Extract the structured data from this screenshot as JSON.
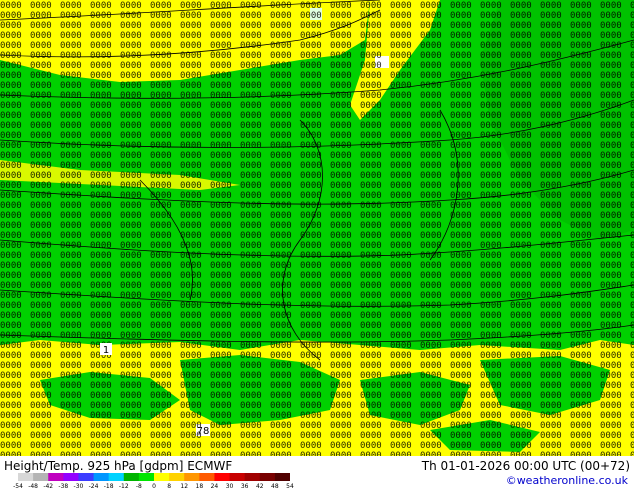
{
  "title": {
    "left": "Height/Temp. 925 hPa [gdpm] ECMWF",
    "right": "Th 01-01-2026 00:00 UTC (00+72)"
  },
  "credit": "©weatheronline.co.uk",
  "colorbar": {
    "ticks": [
      "-54",
      "-48",
      "-42",
      "-38",
      "-30",
      "-24",
      "-18",
      "-12",
      "-8",
      "0",
      "8",
      "12",
      "18",
      "24",
      "30",
      "36",
      "42",
      "48",
      "54"
    ],
    "colors": [
      "#d7d7d7",
      "#b4b4b4",
      "#c000c0",
      "#9300ff",
      "#3c3cff",
      "#0096ff",
      "#00d2ff",
      "#00b400",
      "#00e600",
      "#ffff00",
      "#ffd200",
      "#ff9600",
      "#ff5a00",
      "#ff0000",
      "#c80000",
      "#a00000",
      "#780000",
      "#500000"
    ]
  },
  "map": {
    "colors": {
      "green": "#00d100",
      "dark_green": "#00a800",
      "yellow": "#ffff00",
      "white": "#ffffff"
    },
    "station_labels": [
      "1",
      "78"
    ]
  }
}
